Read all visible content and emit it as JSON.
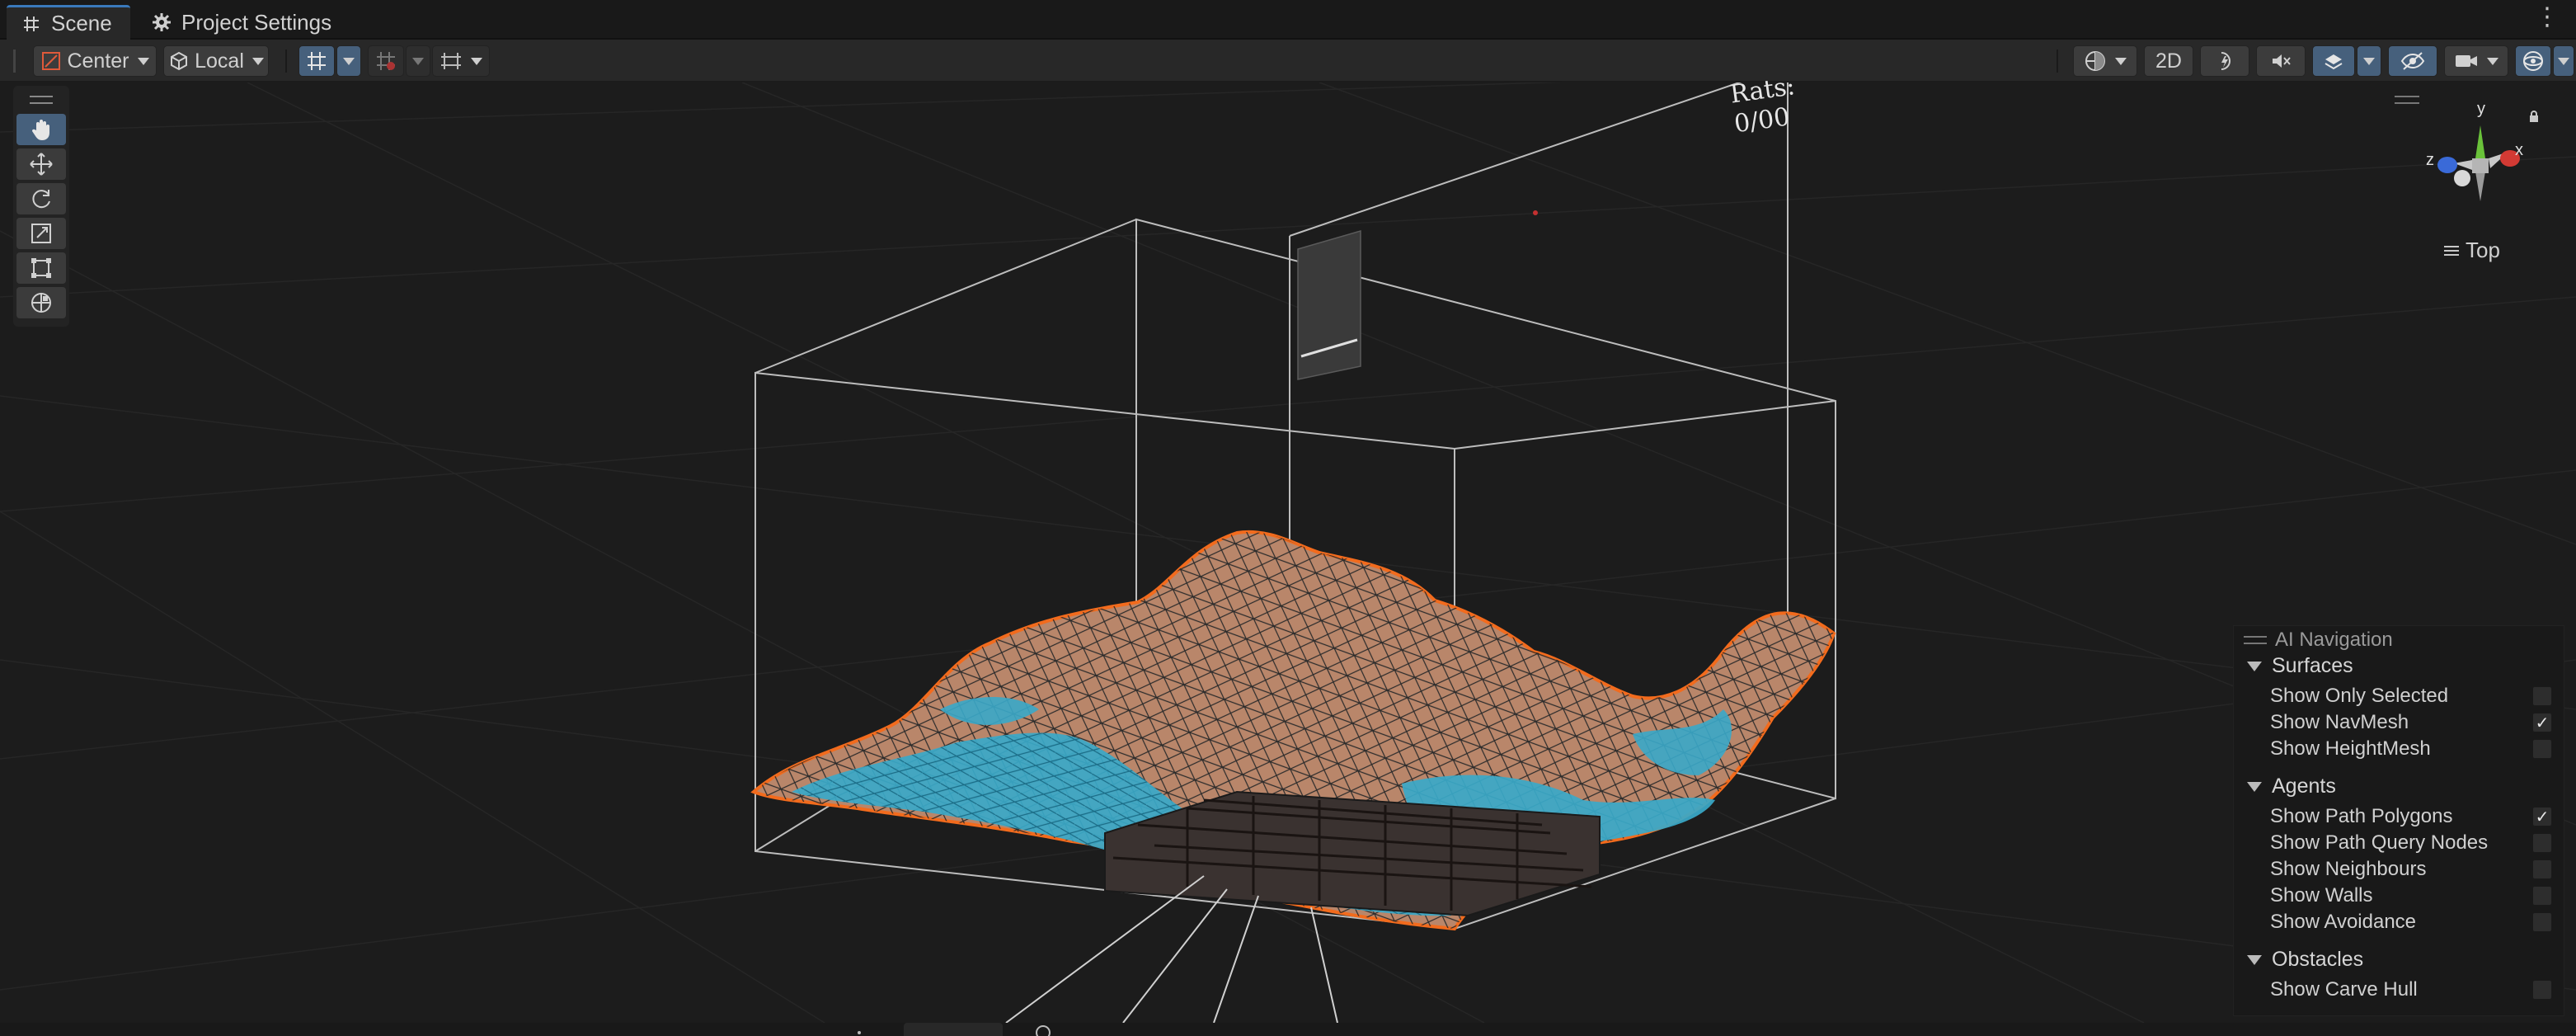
{
  "tabs": [
    {
      "label": "Scene",
      "icon": "grid-icon",
      "active": true
    },
    {
      "label": "Project Settings",
      "icon": "gear-icon",
      "active": false
    }
  ],
  "toolbar": {
    "pivot_position": "Center",
    "pivot_rotation": "Local",
    "mode_2d": "2D"
  },
  "gizmo": {
    "axis_y": "y",
    "axis_x": "x",
    "axis_z": "z",
    "view_label": "Top"
  },
  "scene_text": {
    "rats": "Rats:\n0/00"
  },
  "ai_navigation": {
    "title": "AI Navigation",
    "sections": [
      {
        "label": "Surfaces",
        "options": [
          {
            "label": "Show Only Selected",
            "checked": false
          },
          {
            "label": "Show NavMesh",
            "checked": true
          },
          {
            "label": "Show HeightMesh",
            "checked": false
          }
        ]
      },
      {
        "label": "Agents",
        "options": [
          {
            "label": "Show Path Polygons",
            "checked": true
          },
          {
            "label": "Show Path Query Nodes",
            "checked": false
          },
          {
            "label": "Show Neighbours",
            "checked": false
          },
          {
            "label": "Show Walls",
            "checked": false
          },
          {
            "label": "Show Avoidance",
            "checked": false
          }
        ]
      },
      {
        "label": "Obstacles",
        "options": [
          {
            "label": "Show Carve Hull",
            "checked": false
          }
        ]
      }
    ]
  },
  "colors": {
    "accent": "#3a79bb",
    "selection_outline": "#f26b1d",
    "navmesh": "#3aa9c9",
    "terrain": "#b9866a"
  }
}
